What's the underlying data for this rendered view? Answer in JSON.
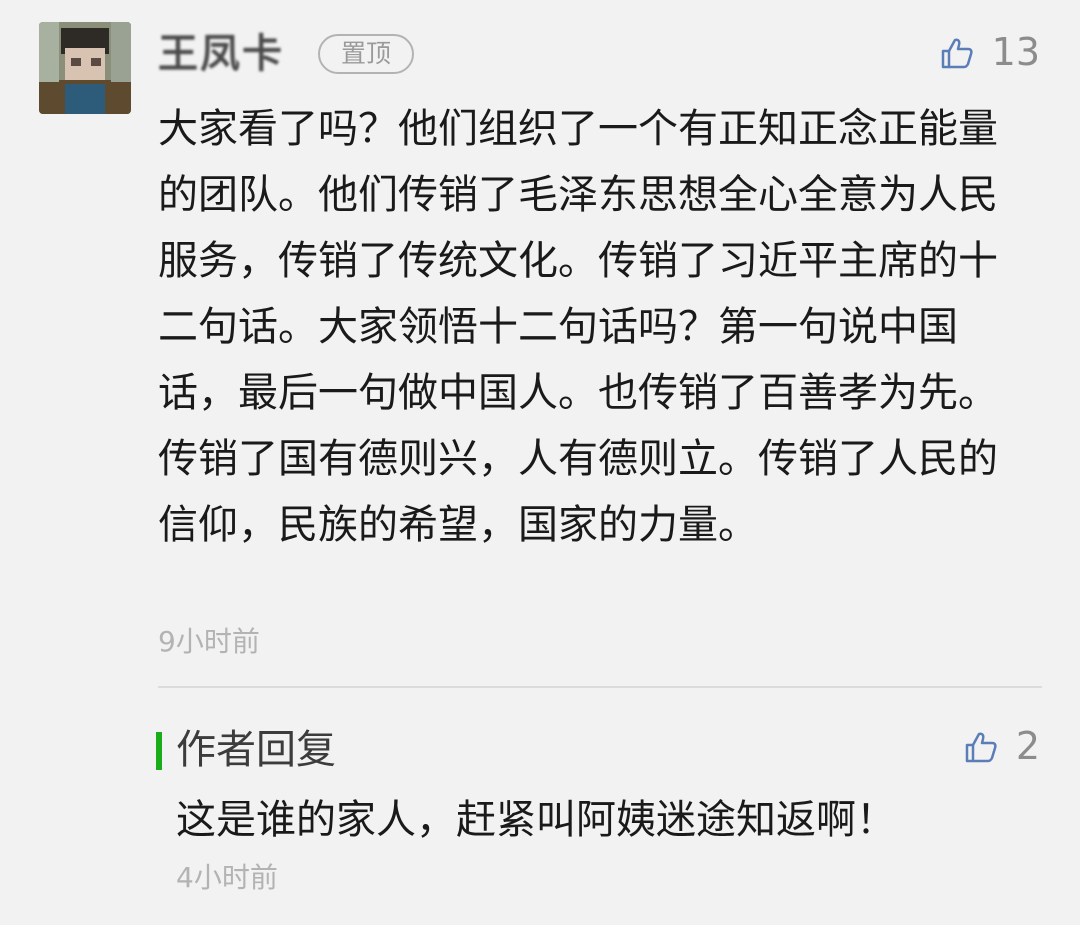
{
  "comment": {
    "username": "王凤卡",
    "pinned_badge": "置顶",
    "likes": "13",
    "text": "大家看了吗？他们组织了一个有正知正念正能量的团队。他们传销了毛泽东思想全心全意为人民服务，传销了传统文化。传销了习近平主席的十二句话。大家领悟十二句话吗？第一句说中国话，最后一句做中国人。也传销了百善孝为先。传销了国有德则兴，人有德则立。传销了人民的信仰，民族的希望，国家的力量。",
    "time": "9小时前"
  },
  "reply": {
    "title": "作者回复",
    "likes": "2",
    "text": "这是谁的家人，赶紧叫阿姨迷途知返啊！",
    "time": "4小时前"
  },
  "colors": {
    "background": "#f2f2f2",
    "reply_accent": "#1aad19",
    "thumb_icon": "#5b7db8"
  },
  "icons": {
    "like": "thumbs-up-icon",
    "avatar": "pixelated-avatar"
  }
}
